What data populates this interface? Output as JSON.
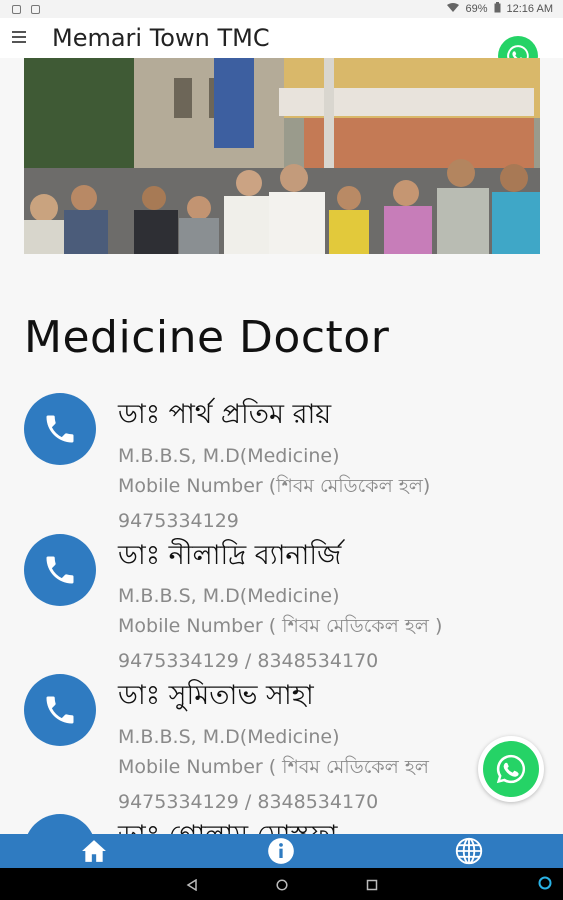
{
  "status_bar": {
    "battery": "69%",
    "time": "12:16 AM"
  },
  "app_bar": {
    "title": "Memari Town TMC",
    "menu_icon": "hamburger-menu-icon",
    "whatsapp_icon": "whatsapp-icon"
  },
  "banner": {
    "description_icon": "photo-banner"
  },
  "section": {
    "title": "Medicine Doctor"
  },
  "doctors": [
    {
      "name": "ডাঃ পার্থ প্রতিম রায়",
      "degree": "M.B.B.S, M.D(Medicine)",
      "mobile_label": "Mobile Number (শিবম মেডিকেল হল)",
      "phone": "9475334129"
    },
    {
      "name": "ডাঃ নীলাদ্রি ব্যানার্জি",
      "degree": "M.B.B.S, M.D(Medicine)",
      "mobile_label": "Mobile Number ( শিবম মেডিকেল হল )",
      "phone": "9475334129 / 8348534170"
    },
    {
      "name": "ডাঃ সুমিতাভ সাহা",
      "degree": "M.B.B.S, M.D(Medicine)",
      "mobile_label": "Mobile Number ( শিবম মেডিকেল হল",
      "phone": "9475334129 / 8348534170"
    },
    {
      "name": "ডাঃ গোলাম মোস্তফা",
      "degree": "",
      "mobile_label": "",
      "phone": ""
    }
  ],
  "colors": {
    "primary": "#2f7bc1",
    "whatsapp": "#25d366"
  },
  "bottom_nav": {
    "items": [
      "home-icon",
      "info-icon",
      "globe-icon"
    ]
  },
  "system_nav": {
    "items": [
      "back-icon",
      "home-circle-icon",
      "recents-icon",
      "assistant-icon"
    ]
  }
}
